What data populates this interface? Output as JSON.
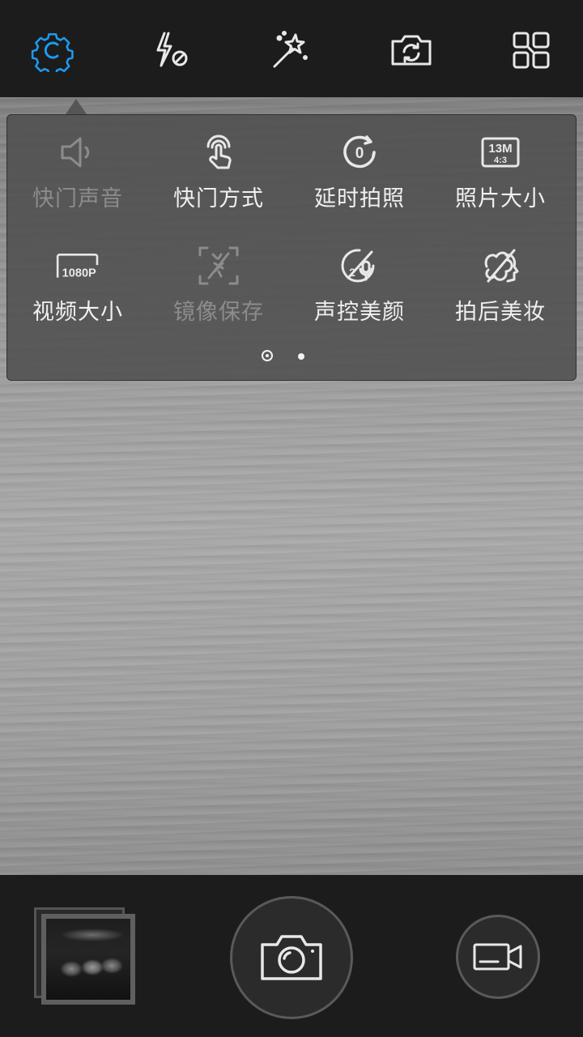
{
  "colors": {
    "accent": "#1e9af0",
    "icon": "#e8e8e8",
    "icon_disabled": "#8c8c8c",
    "bar_background": "#1c1c1c"
  },
  "top_bar": {
    "items": [
      {
        "name": "settings",
        "icon": "gear-icon",
        "active": true
      },
      {
        "name": "flash-off",
        "icon": "flash-off-icon"
      },
      {
        "name": "effects",
        "icon": "magic-wand-icon"
      },
      {
        "name": "switch-camera",
        "icon": "switch-camera-icon"
      },
      {
        "name": "modes",
        "icon": "grid-modes-icon"
      }
    ]
  },
  "settings_panel": {
    "page": 1,
    "page_count": 2,
    "options": [
      {
        "label": "快门声音",
        "icon": "speaker-icon",
        "enabled": false
      },
      {
        "label": "快门方式",
        "icon": "touch-icon",
        "enabled": true
      },
      {
        "label": "延时拍照",
        "icon": "timer-icon",
        "enabled": true,
        "badge": "0"
      },
      {
        "label": "照片大小",
        "icon": "photo-size-icon",
        "enabled": true,
        "badge": "13M",
        "badge_sub": "4:3"
      },
      {
        "label": "视频大小",
        "icon": "video-size-icon",
        "enabled": true,
        "badge": "1080P"
      },
      {
        "label": "镜像保存",
        "icon": "mirror-icon",
        "enabled": false
      },
      {
        "label": "声控美颜",
        "icon": "voice-beauty-icon",
        "enabled": true,
        "badge": "2"
      },
      {
        "label": "拍后美妆",
        "icon": "makeup-icon",
        "enabled": true
      }
    ]
  },
  "bottom_bar": {
    "gallery": "gallery-thumbnail",
    "shutter": "camera-icon",
    "video": "video-camera-icon"
  }
}
